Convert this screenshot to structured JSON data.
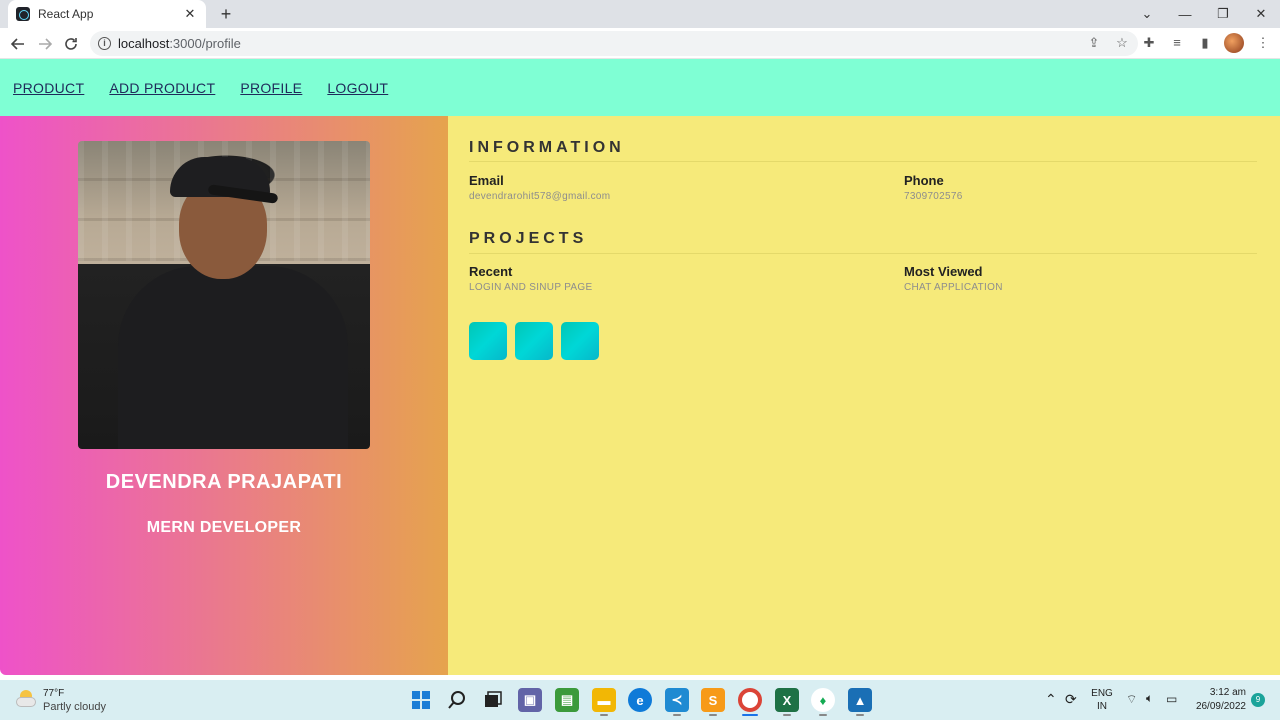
{
  "browser": {
    "tab_title": "React App",
    "tab_close": "✕",
    "new_tab": "+",
    "url_host": "localhost",
    "url_path": ":3000/profile",
    "window_controls": [
      "⌄",
      "—",
      "❐",
      "✕"
    ]
  },
  "app_nav": {
    "items": [
      "PRODUCT",
      "ADD PRODUCT",
      "PROFILE",
      "LOGOUT"
    ]
  },
  "profile": {
    "name": "DEVENDRA PRAJAPATI",
    "role": "MERN DEVELOPER"
  },
  "information": {
    "title": "INFORMATION",
    "email_label": "Email",
    "email_value": "devendrarohit578@gmail.com",
    "phone_label": "Phone",
    "phone_value": "7309702576"
  },
  "projects": {
    "title": "PROJECTS",
    "recent_label": "Recent",
    "recent_value": "LOGIN AND SINUP PAGE",
    "most_viewed_label": "Most Viewed",
    "most_viewed_value": "CHAT APPLICATION"
  },
  "social": {
    "count": 3,
    "color": "#00c6c6"
  },
  "taskbar": {
    "temperature": "77°F",
    "weather": "Partly cloudy",
    "lang_line1": "ENG",
    "lang_line2": "IN",
    "time": "3:12 am",
    "date": "26/09/2022",
    "notifications": "9"
  },
  "colors": {
    "nav_bg": "#7fffd4",
    "panel_gradient_start": "#ee52c9",
    "panel_gradient_end": "#e6a34d",
    "right_bg": "#f6ea7a"
  }
}
